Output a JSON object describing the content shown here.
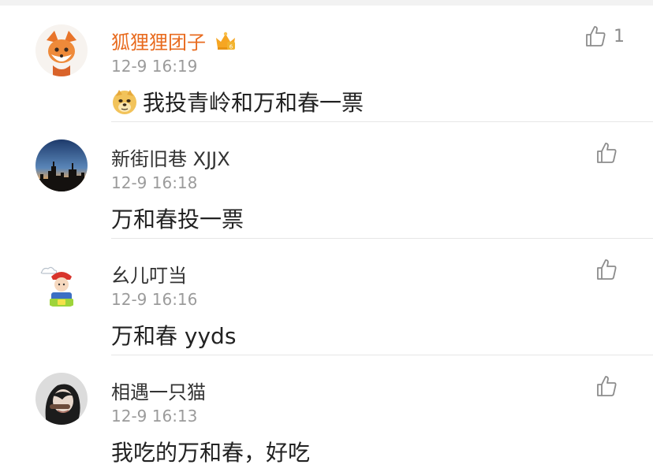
{
  "comments": [
    {
      "name": "狐狸狸团子",
      "time": "12-9 16:19",
      "text": "我投青岭和万和春一票",
      "likes": "1",
      "avatar_icon": "fox-avatar-icon",
      "badge_icon": "crown-badge-icon",
      "emoji_icon": "doge-emoji-icon",
      "name_color": "#e86b1f"
    },
    {
      "name": "新街旧巷 XJJX",
      "time": "12-9 16:18",
      "text": "万和春投一票",
      "likes": "",
      "avatar_icon": "city-skyline-avatar-icon"
    },
    {
      "name": "幺儿叮当",
      "time": "12-9 16:16",
      "text": "万和春 yyds",
      "likes": "",
      "avatar_icon": "cartoon-avatar-icon"
    },
    {
      "name": "相遇一只猫",
      "time": "12-9 16:13",
      "text": "我吃的万和春，好吃",
      "likes": "",
      "avatar_icon": "photo-avatar-icon"
    }
  ],
  "colors": {
    "name_default": "#333333",
    "time": "#9b9b9b",
    "icon": "#8c8c8c"
  }
}
